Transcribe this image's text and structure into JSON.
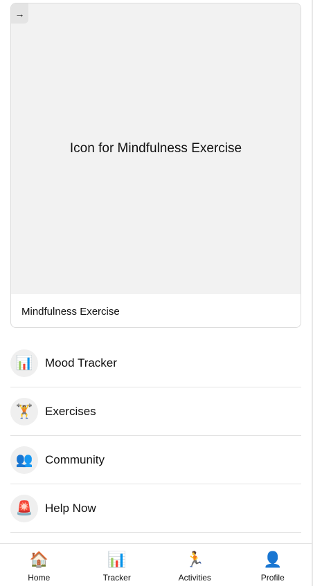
{
  "card": {
    "back_icon": "→",
    "image_text": "Icon for Mindfulness Exercise",
    "caption": "Mindfulness Exercise"
  },
  "menu": {
    "items": [
      {
        "icon": "📊",
        "icon_name": "bar-chart-icon",
        "label": "Mood Tracker"
      },
      {
        "icon": "🏋️",
        "icon_name": "weightlifter-icon",
        "label": "Exercises"
      },
      {
        "icon": "👥",
        "icon_name": "people-icon",
        "label": "Community"
      },
      {
        "icon": "🚨",
        "icon_name": "siren-icon",
        "label": "Help Now"
      }
    ]
  },
  "bottom_nav": {
    "items": [
      {
        "icon": "🏠",
        "icon_name": "house-icon",
        "label": "Home"
      },
      {
        "icon": "📊",
        "icon_name": "bar-chart-icon",
        "label": "Tracker"
      },
      {
        "icon": "🏃",
        "icon_name": "runner-icon",
        "label": "Activities"
      },
      {
        "icon": "👤",
        "icon_name": "user-silhouette-icon",
        "label": "Profile"
      }
    ]
  }
}
